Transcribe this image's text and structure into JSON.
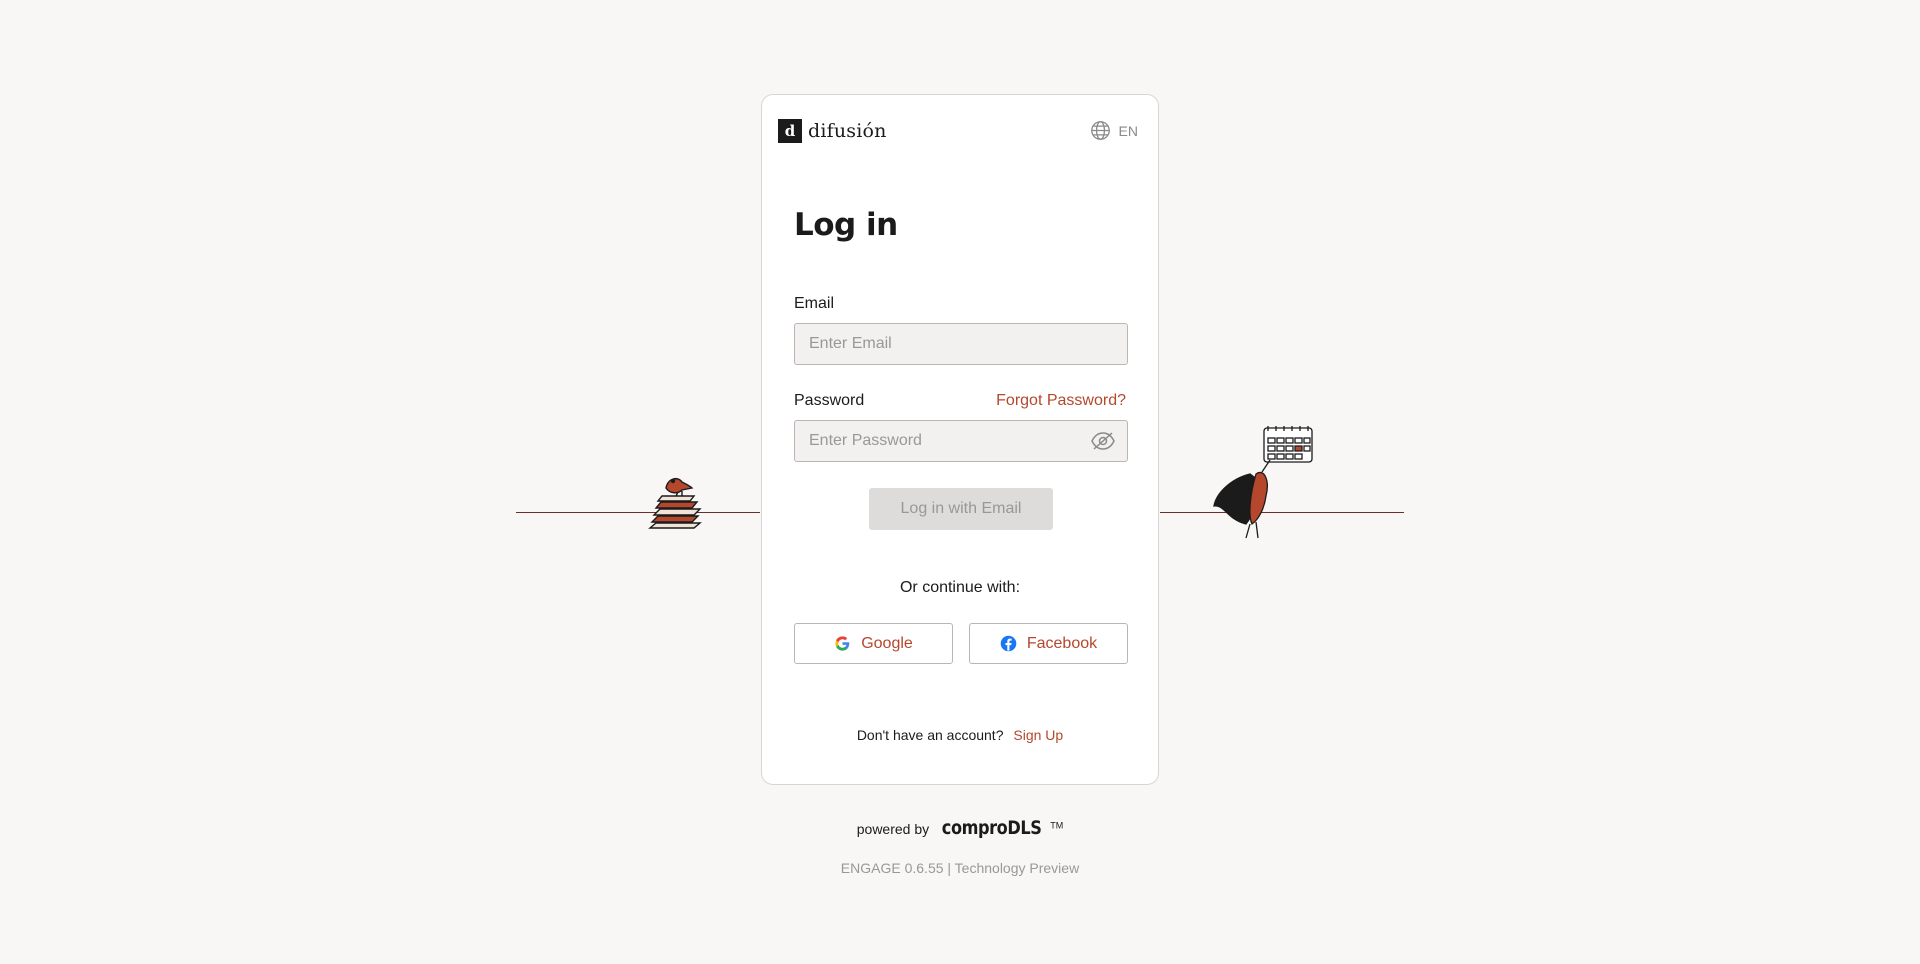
{
  "brand": {
    "mark": "d",
    "name": "difusión"
  },
  "language": {
    "code": "EN",
    "icon": "globe-icon"
  },
  "login": {
    "title": "Log in",
    "email_label": "Email",
    "email_placeholder": "Enter Email",
    "email_value": "",
    "password_label": "Password",
    "forgot_label": "Forgot Password?",
    "password_placeholder": "Enter Password",
    "password_value": "",
    "password_toggle_icon": "eye-slash-icon",
    "submit_label": "Log in with Email",
    "submit_enabled": false
  },
  "social": {
    "heading": "Or continue with:",
    "google_label": "Google",
    "facebook_label": "Facebook"
  },
  "signup": {
    "prompt": "Don't have an account?",
    "link": "Sign Up"
  },
  "footer": {
    "powered_by": "powered by",
    "logo": "comproDLS",
    "trademark": "TM",
    "version": "ENGAGE 0.6.55 | Technology Preview"
  },
  "colors": {
    "accent": "#b5472c",
    "background": "#f8f7f5",
    "input_bg": "#f2f1f0",
    "disabled_btn": "#dedcda"
  }
}
